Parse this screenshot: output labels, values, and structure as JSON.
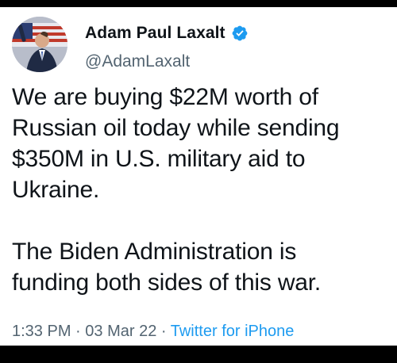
{
  "author": {
    "name": "Adam Paul Laxalt",
    "handle": "@AdamLaxalt",
    "verified": true
  },
  "tweet": {
    "text": "We are buying $22M worth of\nRussian oil today while sending\n$350M in U.S. military aid to\nUkraine.\n\nThe Biden Administration is\nfunding both sides of this war."
  },
  "meta": {
    "time": "1:33 PM",
    "separator1": " · ",
    "date": "03 Mar 22",
    "separator2": " · ",
    "source": "Twitter for iPhone"
  },
  "colors": {
    "verified_badge": "#1d9bf0",
    "source_link": "#1d9bf0",
    "secondary_text": "#536471",
    "primary_text": "#0f1419"
  }
}
